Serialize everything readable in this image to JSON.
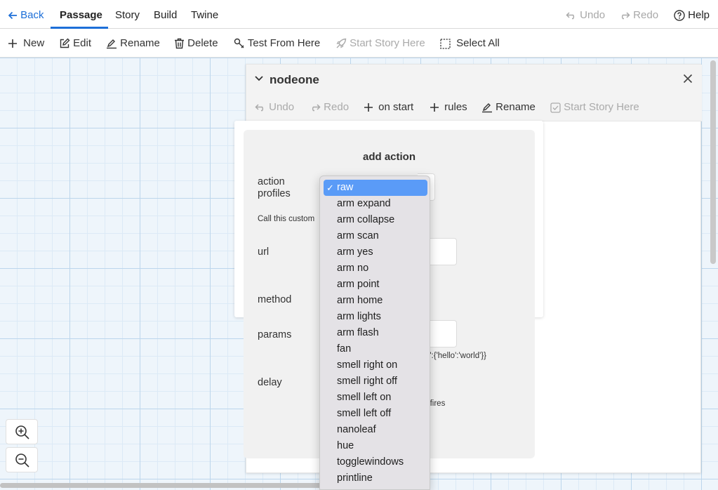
{
  "topnav": {
    "back": "Back",
    "tabs": [
      "Passage",
      "Story",
      "Build",
      "Twine"
    ],
    "undo": "Undo",
    "redo": "Redo",
    "help": "Help"
  },
  "toolbar": {
    "new": "New",
    "edit": "Edit",
    "rename": "Rename",
    "delete": "Delete",
    "test_from_here": "Test From Here",
    "start_story_here": "Start Story Here",
    "select_all": "Select All"
  },
  "dialog": {
    "title": "nodeone",
    "undo": "Undo",
    "redo": "Redo",
    "on_start": "on start",
    "rules": "rules",
    "rename": "Rename",
    "start_story_here": "Start Story Here"
  },
  "form": {
    "title": "add action",
    "action_profiles_label": "action profiles",
    "call_custom_text": "Call this custom",
    "url_label": "url",
    "method_label": "method",
    "params_label": "params",
    "params_hint": "ing':{'hello':'world'}}",
    "delay_label": "delay",
    "delay_hint": "n fires"
  },
  "dropdown": {
    "selected": "raw",
    "options": [
      "raw",
      "arm expand",
      "arm collapse",
      "arm scan",
      "arm yes",
      "arm no",
      "arm point",
      "arm home",
      "arm lights",
      "arm flash",
      "fan",
      "smell right on",
      "smell right off",
      "smell left on",
      "smell left off",
      "nanoleaf",
      "hue",
      "togglewindows",
      "printline"
    ]
  },
  "colors": {
    "accent": "#1d6fd8",
    "selected_option": "#5a9bf7",
    "grid_major": "#bcd6ec",
    "grid_minor": "#dceaf6"
  }
}
